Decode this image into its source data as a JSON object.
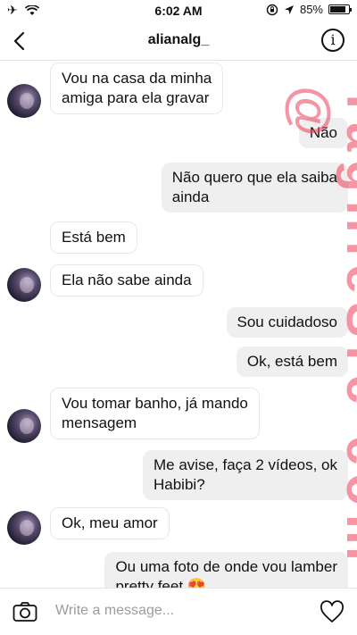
{
  "status_bar": {
    "time": "6:02 AM",
    "battery": "85%",
    "battery_level": 0.85
  },
  "header": {
    "title": "alianalg_"
  },
  "messages": [
    {
      "dir": "in",
      "text": "Vou na casa da minha\namiga para ela gravar",
      "avatar": true
    },
    {
      "dir": "out",
      "text": "Não"
    },
    {
      "dir": "out",
      "text": "Não quero que ela saiba\nainda"
    },
    {
      "dir": "in",
      "text": "Está bem",
      "avatar": false
    },
    {
      "dir": "in",
      "text": "Ela não sabe ainda",
      "avatar": true
    },
    {
      "dir": "out",
      "text": "Sou cuidadoso"
    },
    {
      "dir": "out",
      "text": "Ok, está bem"
    },
    {
      "dir": "in",
      "text": "Vou tomar banho, já mando\nmensagem",
      "avatar": true
    },
    {
      "dir": "out",
      "text": "Me avise, faça 2 vídeos, ok\nHabibi?"
    },
    {
      "dir": "in",
      "text": "Ok, meu amor",
      "avatar": true
    },
    {
      "dir": "out",
      "text": "Ou uma foto de onde vou lamber\npretty feet 😍"
    }
  ],
  "watermark": "TagnieSrc com @",
  "composer": {
    "placeholder": "Write a message..."
  },
  "icons": {
    "airplane": "airplane-icon",
    "wifi": "wifi-icon",
    "rotation_lock": "rotation-lock-icon",
    "location": "location-icon",
    "back": "chevron-left-icon",
    "info": "info-icon",
    "camera": "camera-icon",
    "heart": "heart-icon"
  }
}
